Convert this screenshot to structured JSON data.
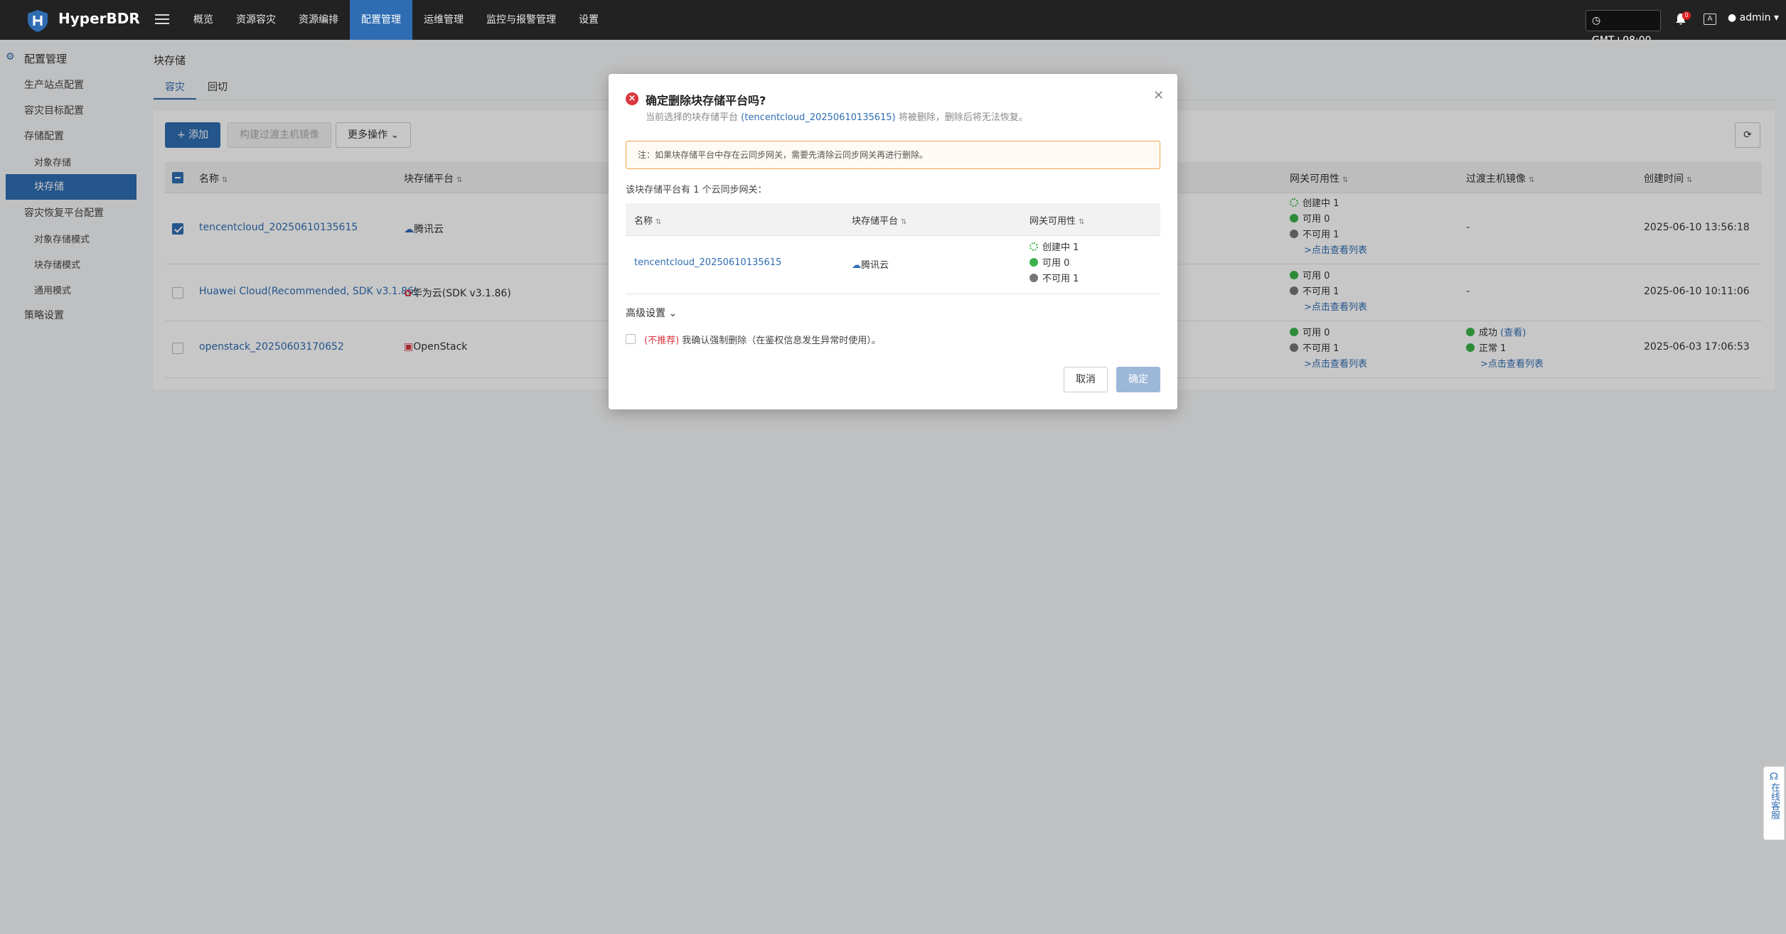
{
  "topbar": {
    "brand": "HyperBDR",
    "nav": [
      "概览",
      "资源容灾",
      "资源编排",
      "配置管理",
      "运维管理",
      "监控与报警管理",
      "设置"
    ],
    "timezone": "GMT+08:00",
    "notification_count": "0",
    "lang_icon": "A",
    "user": "admin"
  },
  "sidebar": {
    "title": "配置管理",
    "items": [
      {
        "label": "生产站点配置"
      },
      {
        "label": "容灾目标配置"
      },
      {
        "label": "存储配置"
      },
      {
        "label": "对象存储"
      },
      {
        "label": "块存储"
      },
      {
        "label": "容灾恢复平台配置"
      },
      {
        "label": "对象存储模式"
      },
      {
        "label": "块存储模式"
      },
      {
        "label": "通用模式"
      },
      {
        "label": "策略设置"
      }
    ]
  },
  "main": {
    "title": "块存储",
    "tabs": [
      "容灾",
      "回切"
    ],
    "toolbar": {
      "add": "+ 添加",
      "build": "构建过渡主机镜像",
      "more": "更多操作"
    },
    "columns": [
      "名称",
      "块存储平台",
      "网关可用性",
      "过渡主机镜像",
      "创建时间"
    ],
    "rows": [
      {
        "name": "tencentcloud_20250610135615",
        "platform": "腾讯云",
        "gw": [
          "创建中 1",
          "可用 0",
          "不可用 1"
        ],
        "gw_link": ">点击查看列表",
        "image": "-",
        "created": "2025-06-10 13:56:18"
      },
      {
        "name": "Huawei Cloud(Recommended, SDK v3.1.86)",
        "platform": "华为云(SDK v3.1.86)",
        "gw": [
          "可用 0",
          "不可用 1"
        ],
        "gw_link": ">点击查看列表",
        "image": "-",
        "created": "2025-06-10 10:11:06"
      },
      {
        "name": "openstack_20250603170652",
        "platform": "OpenStack",
        "gw": [
          "可用 0",
          "不可用 1"
        ],
        "gw_link": ">点击查看列表",
        "image_success": "成功",
        "image_view": "(查看)",
        "image_normal": "正常 1",
        "image_link": ">点击查看列表",
        "created": "2025-06-03 17:06:53"
      }
    ]
  },
  "modal": {
    "title": "确定删除块存储平台吗?",
    "desc_prefix": "当前选择的块存储平台",
    "desc_name": "(tencentcloud_20250610135615)",
    "desc_suffix": "将被删除，删除后将无法恢复。",
    "note": "注：如果块存储平台中存在云同步网关，需要先清除云同步网关再进行删除。",
    "count_text": "该块存储平台有 1 个云同步网关：",
    "columns": [
      "名称",
      "块存储平台",
      "网关可用性"
    ],
    "row": {
      "name": "tencentcloud_20250610135615",
      "platform": "腾讯云",
      "gw": [
        "创建中 1",
        "可用 0",
        "不可用 1"
      ]
    },
    "advanced": "高级设置",
    "force_tag": "(不推荐)",
    "force_text": "我确认强制删除（在鉴权信息发生异常时使用）。",
    "cancel": "取消",
    "ok": "确定"
  },
  "support": "在线客服"
}
